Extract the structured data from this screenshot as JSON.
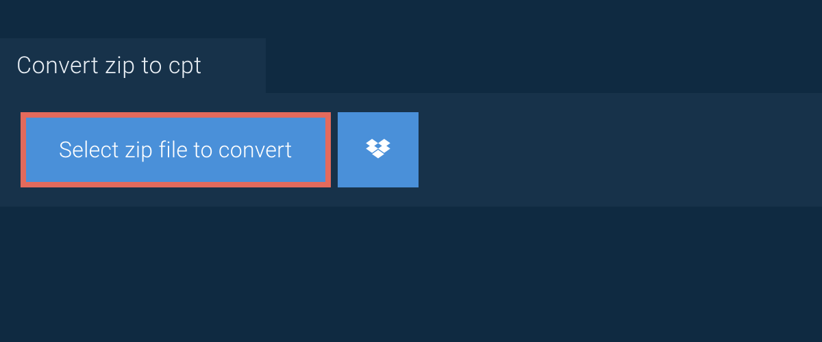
{
  "header": {
    "title": "Convert zip to cpt"
  },
  "actions": {
    "select_label": "Select zip file to convert",
    "dropbox_icon": "dropbox-icon"
  },
  "colors": {
    "bg": "#0f2a41",
    "panel": "#17324a",
    "button": "#4a90d9",
    "highlight_border": "#e36a5c",
    "text_light": "#e8eef4"
  }
}
